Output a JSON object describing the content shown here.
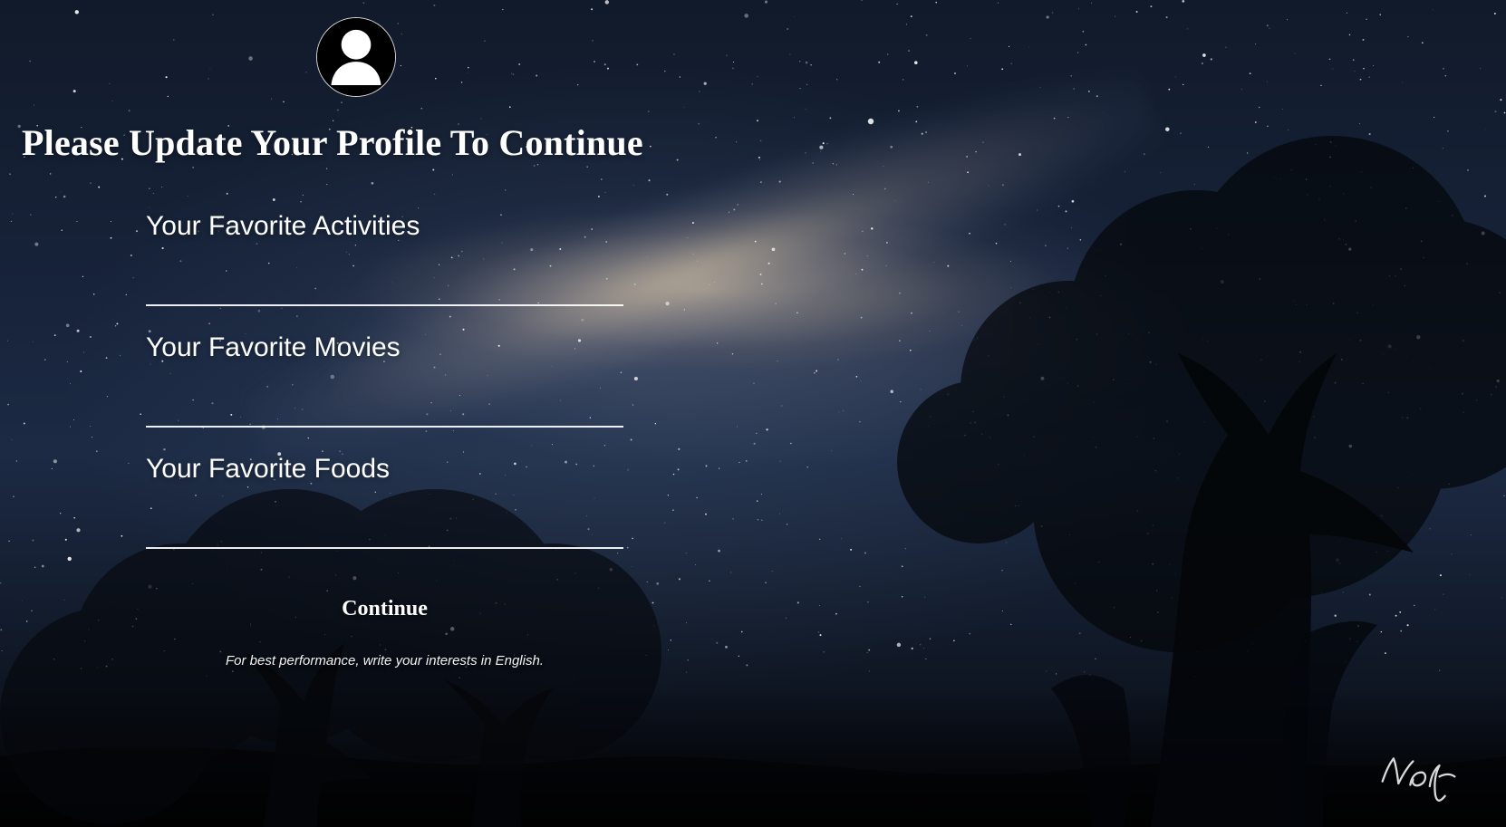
{
  "page": {
    "title": "Please Update Your Profile To Continue"
  },
  "form": {
    "fields": [
      {
        "label": "Your Favorite Activities",
        "value": "",
        "placeholder": ""
      },
      {
        "label": "Your Favorite Movies",
        "value": "",
        "placeholder": ""
      },
      {
        "label": "Your Favorite Foods",
        "value": "",
        "placeholder": ""
      }
    ],
    "continue_label": "Continue",
    "hint": "For best performance, write your interests in English."
  },
  "branding": {
    "signature_text": "Vonfer"
  },
  "icons": {
    "avatar": "user-avatar-icon"
  },
  "colors": {
    "text": "#ffffff",
    "underline": "#ffffff",
    "avatar_bg": "#000000"
  }
}
